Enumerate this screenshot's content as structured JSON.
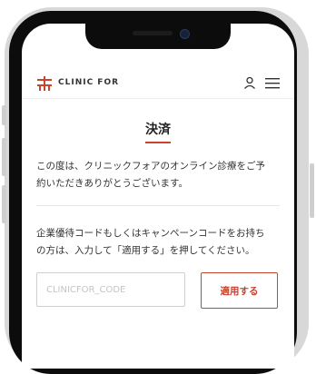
{
  "header": {
    "brand": "CLINIC FOR",
    "logo_icon": "clinic-for-logo",
    "user_icon": "user-icon",
    "menu_icon": "hamburger-menu-icon"
  },
  "page": {
    "title": "決済",
    "intro_line1": "この度は、クリニックフォアのオンライン診療をご予",
    "intro_line2": "約いただきありがとうございます。",
    "coupon_line1": "企業優待コードもしくはキャンペーンコードをお持ち",
    "coupon_line2": "の方は、入力して「適用する」を押してください。"
  },
  "coupon": {
    "placeholder": "CLINICFOR_CODE",
    "value": "",
    "apply_label": "適用する"
  },
  "colors": {
    "accent": "#c8442f",
    "text": "#333333",
    "device_frame": "#0c0c0c"
  }
}
